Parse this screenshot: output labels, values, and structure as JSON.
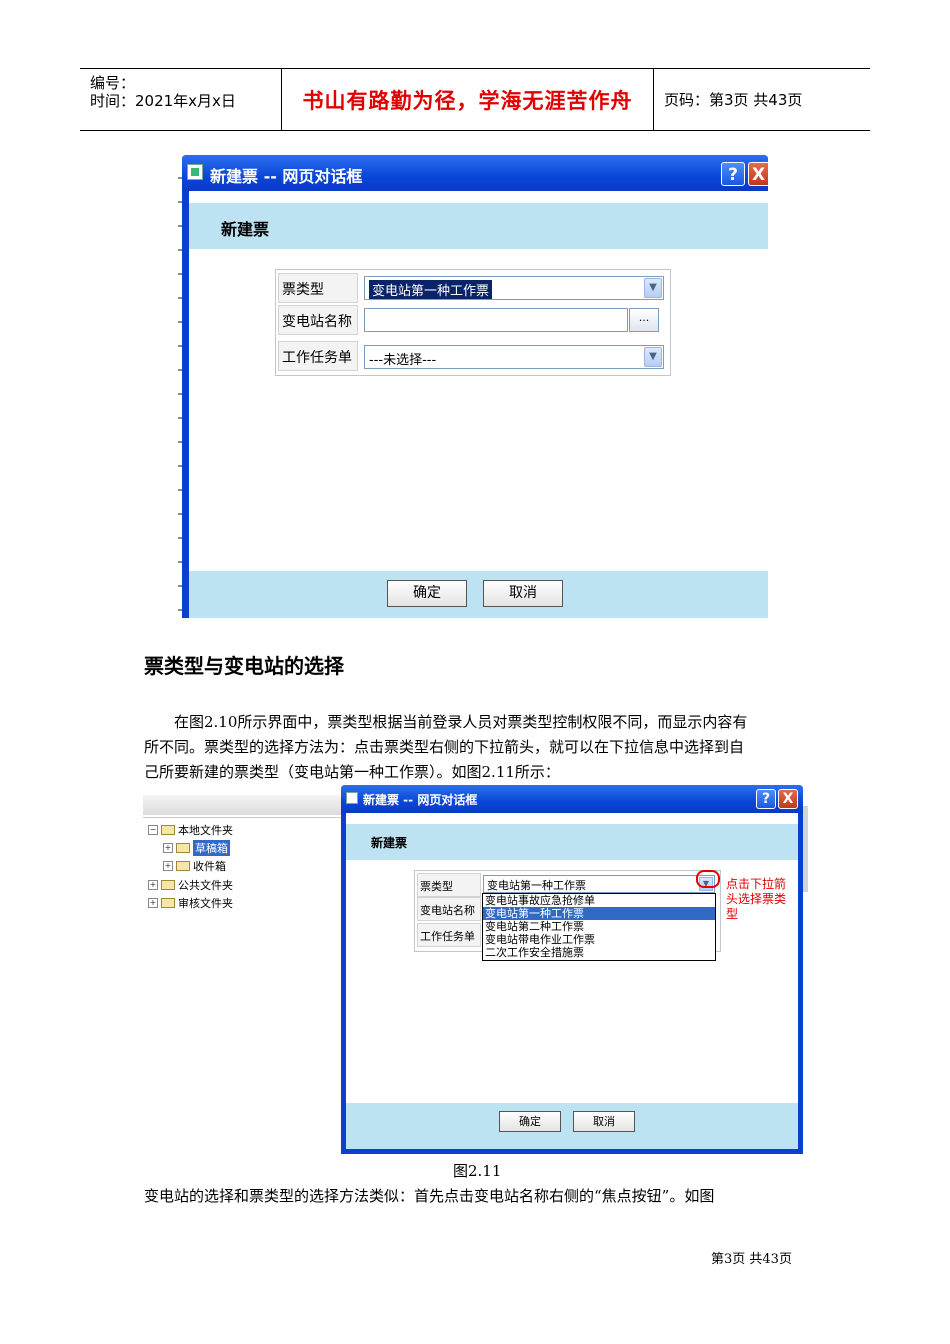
{
  "header": {
    "number_label": "编号：",
    "time_label": "时间：2021年x月x日",
    "motto": "书山有路勤为径，学海无涯苦作舟",
    "page_info": "页码：第3页 共43页"
  },
  "dialog1": {
    "title": "新建票 -- 网页对话框",
    "help": "?",
    "close": "X",
    "heading": "新建票",
    "fields": {
      "ticket_type_label": "票类型",
      "ticket_type_value": "变电站第一种工作票",
      "substation_label": "变电站名称",
      "substation_value": "",
      "browse": "...",
      "task_label": "工作任务单",
      "task_value": "---未选择---"
    },
    "ok": "确定",
    "cancel": "取消"
  },
  "section": {
    "heading": "票类型与变电站的选择",
    "para1_line1": "在图2.10所示界面中，票类型根据当前登录人员对票类型控制权限不同，而显示内容有",
    "para1_line2": "所不同。票类型的选择方法为：点击票类型右侧的下拉箭头，就可以在下拉信息中选择到自",
    "para1_line3": "己所要新建的票类型（变电站第一种工作票）。如图2.11所示：",
    "caption": "图2.11",
    "para2": "变电站的选择和票类型的选择方法类似：首先点击变电站名称右侧的“焦点按钮”。如图"
  },
  "tree": {
    "items": [
      "本地文件夹",
      "草稿箱",
      "收件箱",
      "公共文件夹",
      "审核文件夹"
    ]
  },
  "dialog2": {
    "title": "新建票 -- 网页对话框",
    "help": "?",
    "close": "X",
    "heading": "新建票",
    "ticket_type_label": "票类型",
    "ticket_type_value": "变电站第一种工作票",
    "substation_label": "变电站名称",
    "task_label": "工作任务单",
    "options": [
      "变电站事故应急抢修单",
      "变电站第一种工作票",
      "变电站第二种工作票",
      "变电站带电作业工作票",
      "二次工作安全措施票"
    ],
    "selected_index": 1,
    "annotation": "点击下拉箭头选择票类型",
    "ok": "确定",
    "cancel": "取消"
  },
  "footer": "第3页 共43页"
}
